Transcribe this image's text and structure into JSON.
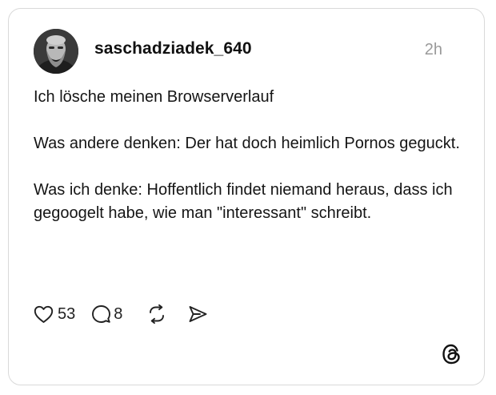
{
  "post": {
    "username": "saschadziadek_640",
    "timestamp": "2h",
    "paragraphs": [
      "Ich lösche meinen Browserverlauf",
      "Was andere denken: Der hat doch heimlich Pornos geguckt.",
      "Was ich denke: Hoffentlich findet niemand heraus, dass ich gegoogelt habe, wie man \"interessant\" schreibt."
    ],
    "likes": "53",
    "replies": "8"
  },
  "icons": {
    "like": "heart-icon",
    "reply": "comment-bubble-icon",
    "repost": "repost-icon",
    "share": "send-icon",
    "brand": "threads-logo-icon"
  }
}
